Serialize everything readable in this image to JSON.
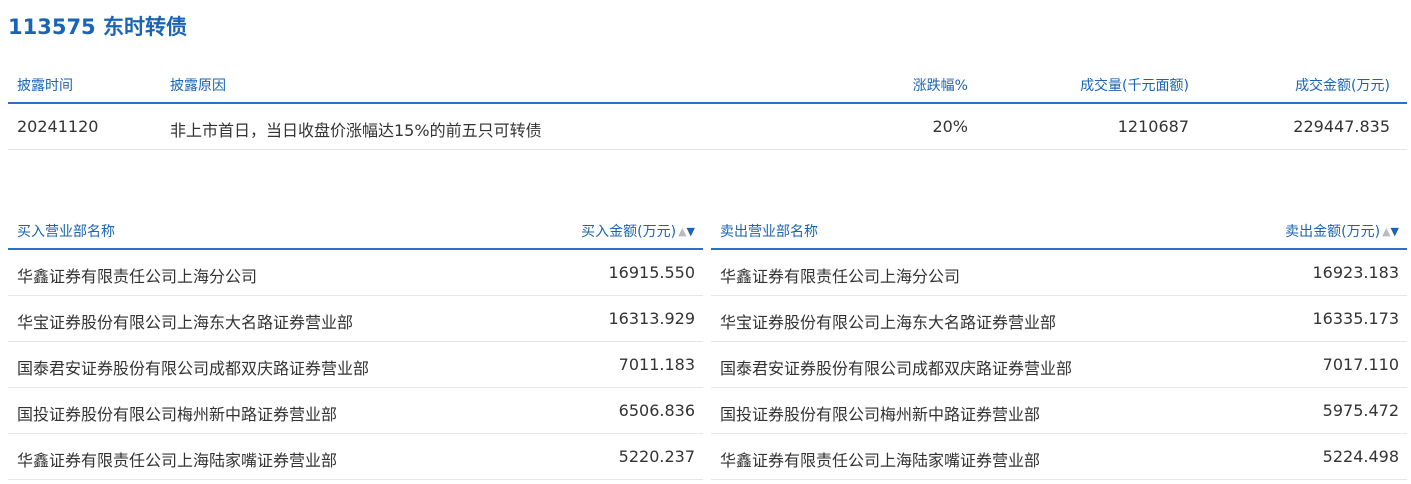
{
  "title": "113575 东时转债",
  "disclosure": {
    "headers": {
      "time": "披露时间",
      "reason": "披露原因",
      "change_pct": "涨跌幅%",
      "volume": "成交量(千元面额)",
      "amount": "成交金额(万元)"
    },
    "rows": [
      {
        "time": "20241120",
        "reason": "非上市首日，当日收盘价涨幅达15%的前五只可转债",
        "change_pct": "20%",
        "volume": "1210687",
        "amount": "229447.835"
      }
    ]
  },
  "buy": {
    "headers": {
      "name": "买入营业部名称",
      "amount": "买入金额(万元)"
    },
    "sort_up": "▲",
    "sort_down": "▼",
    "rows": [
      {
        "name": "华鑫证券有限责任公司上海分公司",
        "amount": "16915.550"
      },
      {
        "name": "华宝证券股份有限公司上海东大名路证券营业部",
        "amount": "16313.929"
      },
      {
        "name": "国泰君安证券股份有限公司成都双庆路证券营业部",
        "amount": "7011.183"
      },
      {
        "name": "国投证券股份有限公司梅州新中路证券营业部",
        "amount": "6506.836"
      },
      {
        "name": "华鑫证券有限责任公司上海陆家嘴证券营业部",
        "amount": "5220.237"
      }
    ]
  },
  "sell": {
    "headers": {
      "name": "卖出营业部名称",
      "amount": "卖出金额(万元)"
    },
    "sort_up": "▲",
    "sort_down": "▼",
    "rows": [
      {
        "name": "华鑫证券有限责任公司上海分公司",
        "amount": "16923.183"
      },
      {
        "name": "华宝证券股份有限公司上海东大名路证券营业部",
        "amount": "16335.173"
      },
      {
        "name": "国泰君安证券股份有限公司成都双庆路证券营业部",
        "amount": "7017.110"
      },
      {
        "name": "国投证券股份有限公司梅州新中路证券营业部",
        "amount": "5975.472"
      },
      {
        "name": "华鑫证券有限责任公司上海陆家嘴证券营业部",
        "amount": "5224.498"
      }
    ]
  },
  "colors": {
    "accent": "#1a64b5",
    "header_rule": "#2a71c7",
    "row_rule": "#e3e6ea",
    "text": "#333333",
    "sort_inactive": "#b5bcc6"
  }
}
